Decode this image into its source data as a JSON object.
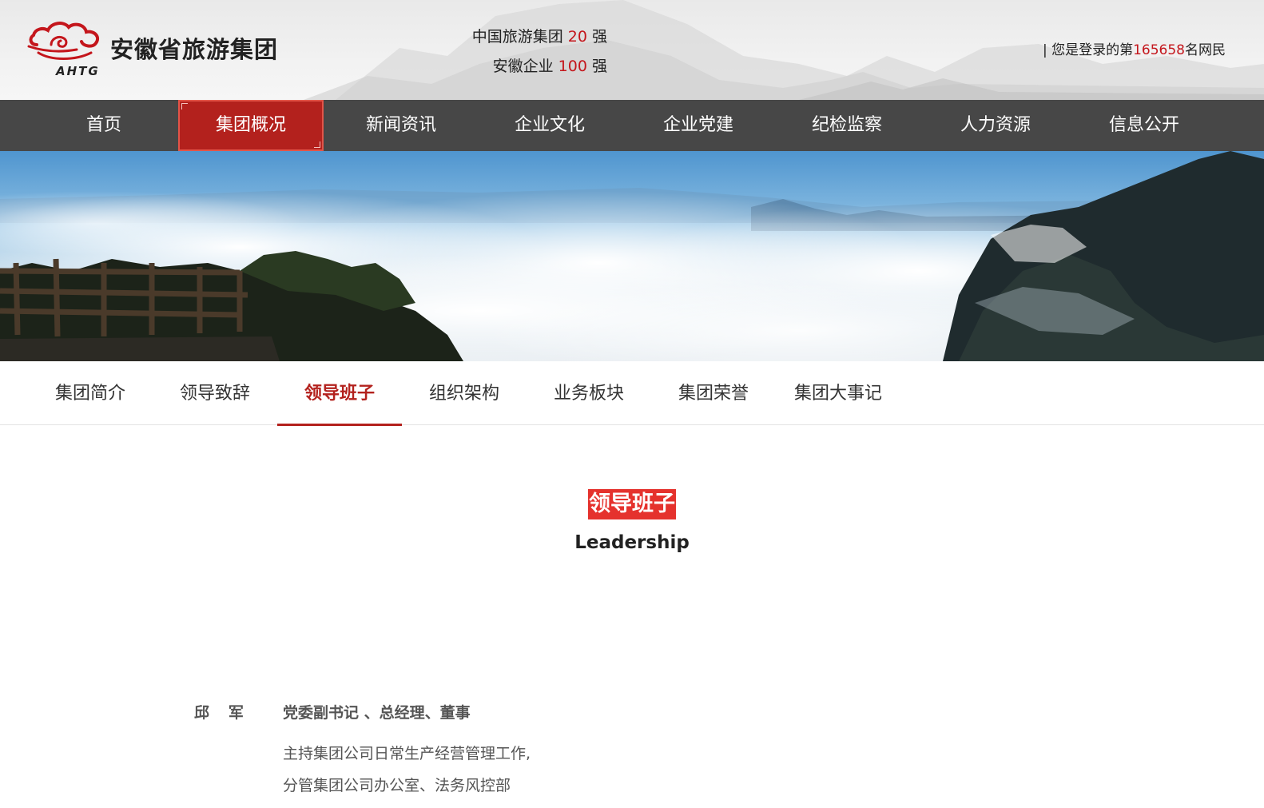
{
  "header": {
    "logo_name": "安徽省旅游集团",
    "logo_abbr": "AHTG",
    "rank_line1_prefix": "中国旅游集团",
    "rank_line1_num": "20",
    "rank_line1_suffix": "强",
    "rank_line2_prefix": "安徽企业",
    "rank_line2_num": "100",
    "rank_line2_suffix": "强",
    "visitor_prefix": "| 您是登录的第",
    "visitor_count": "165658",
    "visitor_suffix": "名网民"
  },
  "main_nav": [
    {
      "label": "首页"
    },
    {
      "label": "集团概况"
    },
    {
      "label": "新闻资讯"
    },
    {
      "label": "企业文化"
    },
    {
      "label": "企业党建"
    },
    {
      "label": "纪检监察"
    },
    {
      "label": "人力资源"
    },
    {
      "label": "信息公开"
    }
  ],
  "main_nav_active": "集团概况",
  "sub_nav": [
    {
      "label": "集团简介"
    },
    {
      "label": "领导致辞"
    },
    {
      "label": "领导班子"
    },
    {
      "label": "组织架构"
    },
    {
      "label": "业务板块"
    },
    {
      "label": "集团荣誉"
    },
    {
      "label": "集团大事记"
    }
  ],
  "sub_nav_active": "领导班子",
  "section": {
    "title_cn": "领导班子",
    "title_en": "Leadership"
  },
  "leaders": [
    {
      "name": "邱   军",
      "title": "党委副书记 、总经理、董事",
      "duties": [
        "主持集团公司日常生产经营管理工作,",
        "分管集团公司办公室、法务风控部"
      ]
    }
  ],
  "colors": {
    "accent_red": "#b3211d",
    "title_red": "#e5322d",
    "nav_bg": "#474747",
    "number_red": "#c4161c"
  }
}
